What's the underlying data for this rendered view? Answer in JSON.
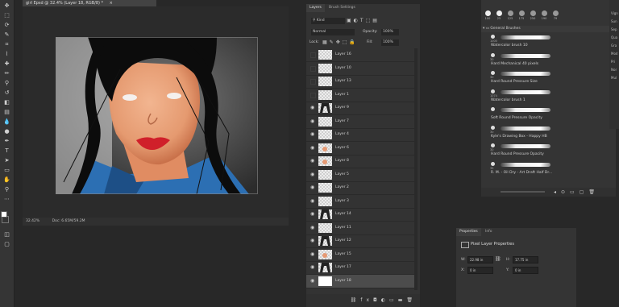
{
  "document": {
    "tab_title": "girl Epsd @ 32.4% (Layer 18, RGB/8) *",
    "zoom": "32.42%",
    "doc_info": "Doc: 6.65M/59.2M"
  },
  "layers_panel": {
    "tabs": [
      "Layers",
      "Brush Settings"
    ],
    "filter_kind": "Kind",
    "blend_mode": "Normal",
    "opacity_label": "Opacity:",
    "opacity_value": "100%",
    "lock_label": "Lock:",
    "fill_label": "Fill:",
    "fill_value": "100%",
    "layers": [
      {
        "name": "Layer 16",
        "visible": false,
        "thumb": "empty"
      },
      {
        "name": "Layer 10",
        "visible": false,
        "thumb": "empty"
      },
      {
        "name": "Layer 13",
        "visible": false,
        "thumb": "empty"
      },
      {
        "name": "Layer 1",
        "visible": false,
        "thumb": "empty"
      },
      {
        "name": "Layer 9",
        "visible": true,
        "thumb": "hair"
      },
      {
        "name": "Layer 7",
        "visible": true,
        "thumb": "empty"
      },
      {
        "name": "Layer 4",
        "visible": true,
        "thumb": "empty"
      },
      {
        "name": "Layer 6",
        "visible": true,
        "thumb": "skin"
      },
      {
        "name": "Layer 8",
        "visible": true,
        "thumb": "skin"
      },
      {
        "name": "Layer 5",
        "visible": true,
        "thumb": "empty"
      },
      {
        "name": "Layer 2",
        "visible": true,
        "thumb": "empty"
      },
      {
        "name": "Layer 3",
        "visible": true,
        "thumb": "empty"
      },
      {
        "name": "Layer 14",
        "visible": true,
        "thumb": "hair"
      },
      {
        "name": "Layer 11",
        "visible": true,
        "thumb": "empty"
      },
      {
        "name": "Layer 12",
        "visible": true,
        "thumb": "hair"
      },
      {
        "name": "Layer 15",
        "visible": true,
        "thumb": "skin"
      },
      {
        "name": "Layer 17",
        "visible": true,
        "thumb": "hair"
      },
      {
        "name": "Layer 18",
        "visible": true,
        "thumb": "white",
        "selected": true
      }
    ]
  },
  "brushes_panel": {
    "sizes": [
      "100",
      "25",
      "125",
      "175",
      "250",
      "190",
      "79"
    ],
    "group_name": "General Brushes",
    "brushes": [
      {
        "name": "Watercolor brush 10",
        "size": "1000"
      },
      {
        "name": "Hard Mechanical 40 pixels",
        "size": "30"
      },
      {
        "name": "Hard Round Pressure Size",
        "size": "30"
      },
      {
        "name": "Watercolor brush 1",
        "size": "1074"
      },
      {
        "name": "Soft Round Pressure Opacity",
        "size": ""
      },
      {
        "name": "Kyle's Drawing Box - Happy HB",
        "size": "30"
      },
      {
        "name": "Hard Round Pressure Opacity",
        "size": "30"
      },
      {
        "name": "R. M. - Oil Dry - Art Draft Half Dr...",
        "size": "35"
      }
    ]
  },
  "properties_panel": {
    "tabs": [
      "Properties",
      "Info"
    ],
    "title": "Pixel Layer Properties",
    "w_label": "W:",
    "w_value": "22.98 in",
    "h_label": "H:",
    "h_value": "17.75 in",
    "x_label": "X:",
    "x_value": "0 in",
    "y_label": "Y:",
    "y_value": "0 in"
  },
  "right_strip": {
    "items": [
      "Vign",
      "Sun",
      "Sep",
      "Qua",
      "Gra",
      "Mod",
      "Pri",
      "Nor",
      "Mul"
    ]
  },
  "colors": {
    "foreground": "#ffffff",
    "background": "#000000"
  }
}
